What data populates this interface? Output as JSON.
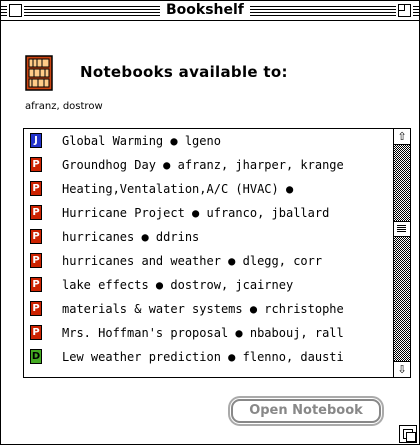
{
  "window": {
    "title": "Bookshelf"
  },
  "header": {
    "heading": "Notebooks available to:",
    "users": "afranz, dostrow"
  },
  "list": {
    "items": [
      {
        "icon": "J",
        "text": "Global Warming ● lgeno"
      },
      {
        "icon": "P",
        "text": "Groundhog Day ● afranz, jharper, krange"
      },
      {
        "icon": "P",
        "text": "Heating,Ventalation,A/C (HVAC) ●"
      },
      {
        "icon": "P",
        "text": "Hurricane Project ● ufranco, jballard"
      },
      {
        "icon": "P",
        "text": "hurricanes ● ddrins"
      },
      {
        "icon": "P",
        "text": "hurricanes and weather ● dlegg, corr"
      },
      {
        "icon": "P",
        "text": "lake effects ● dostrow, jcairney"
      },
      {
        "icon": "P",
        "text": "materials & water systems ● rchristophe"
      },
      {
        "icon": "P",
        "text": "Mrs. Hoffman's proposal ● nbabouj, rall"
      },
      {
        "icon": "D",
        "text": "Lew weather prediction ● flenno, dausti"
      }
    ],
    "scroll_fraction": 0.38
  },
  "buttons": {
    "open": "Open Notebook"
  },
  "icons": {
    "book": "bookshelf-icon",
    "notebook_colors": {
      "P": "#cc2200",
      "J": "#2233cc",
      "D": "#44aa22"
    }
  }
}
